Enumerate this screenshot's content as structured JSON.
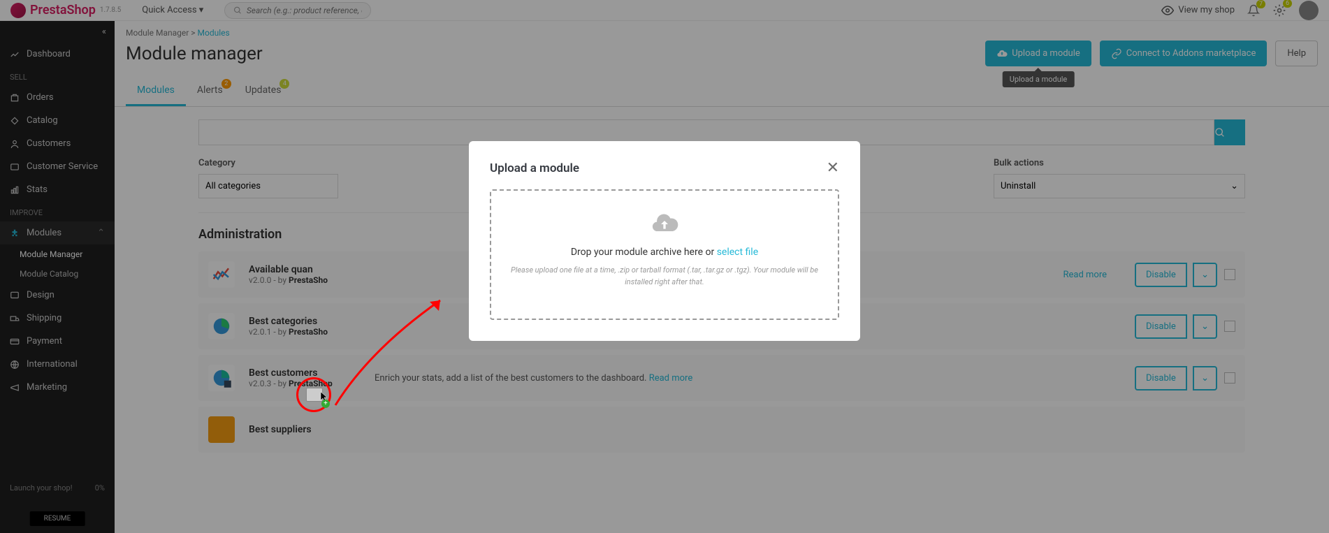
{
  "brand": "PrestaShop",
  "version": "1.7.8.5",
  "quickAccess": "Quick Access",
  "searchPlaceholder": "Search (e.g.: product reference, custon",
  "viewShop": "View my shop",
  "notifBadge": "7",
  "cartBadge": "6",
  "sidebar": {
    "dashboard": "Dashboard",
    "sellHeader": "SELL",
    "orders": "Orders",
    "catalog": "Catalog",
    "customers": "Customers",
    "customerService": "Customer Service",
    "stats": "Stats",
    "improveHeader": "IMPROVE",
    "modules": "Modules",
    "moduleManager": "Module Manager",
    "moduleCatalog": "Module Catalog",
    "design": "Design",
    "shipping": "Shipping",
    "payment": "Payment",
    "international": "International",
    "marketing": "Marketing",
    "launch": "Launch your shop!",
    "launchPct": "0%",
    "resume": "RESUME"
  },
  "breadcrumb": {
    "root": "Module Manager",
    "leaf": "Modules"
  },
  "pageTitle": "Module manager",
  "buttons": {
    "upload": "Upload a module",
    "connect": "Connect to Addons marketplace",
    "help": "Help"
  },
  "tooltip": "Upload a module",
  "tabs": {
    "modules": "Modules",
    "alerts": "Alerts",
    "alertsBadge": "2",
    "updates": "Updates",
    "updatesBadge": "4"
  },
  "filters": {
    "categoryLabel": "Category",
    "categoryValue": "All categories",
    "bulkLabel": "Bulk actions",
    "bulkValue": "Uninstall"
  },
  "admin": {
    "title": "Administration",
    "readMore": "Read more",
    "disable": "Disable",
    "mods": [
      {
        "name": "Available quan",
        "ver": "v2.0.0 - by ",
        "author": "PrestaSho",
        "desc": ""
      },
      {
        "name": "Best categories",
        "ver": "v2.0.1 - by ",
        "author": "PrestaSho",
        "desc": ""
      },
      {
        "name": "Best customers",
        "ver": "v2.0.3 - by ",
        "author": "PrestaShop",
        "desc": "Enrich your stats, add a list of the best customers to the dashboard. "
      },
      {
        "name": "Best suppliers",
        "ver": "",
        "author": "",
        "desc": ""
      }
    ]
  },
  "modal": {
    "title": "Upload a module",
    "dropText": "Drop your module archive here or ",
    "selectFile": "select file",
    "hint": "Please upload one file at a time, .zip or tarball format (.tar, .tar.gz or .tgz). Your module will be installed right after that."
  }
}
